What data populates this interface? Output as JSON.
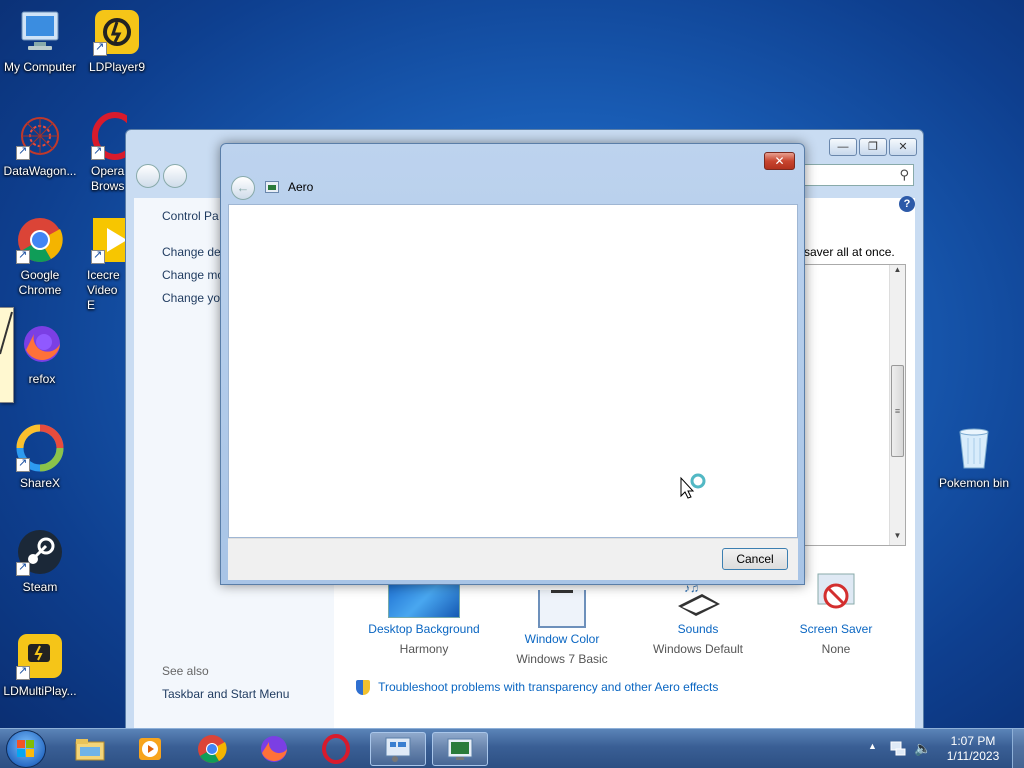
{
  "desktop": {
    "icons": [
      {
        "label": "My Computer"
      },
      {
        "label": "LDPlayer9"
      },
      {
        "label": "DataWagon..."
      },
      {
        "label": "Opera Brows"
      },
      {
        "label": "Google Chrome"
      },
      {
        "label": "Icecre Video E"
      },
      {
        "label": "refox"
      },
      {
        "label": "ShareX"
      },
      {
        "label": "Steam"
      },
      {
        "label": "LDMultiPlay..."
      },
      {
        "label": "Pokemon bin"
      }
    ]
  },
  "personalization": {
    "breadcrumb": "Control Pa",
    "left_links": [
      "Change de",
      "Change mo",
      "Change yo"
    ],
    "description_tail": "saver all at once.",
    "see_also_heading": "See also",
    "see_also_link": "Taskbar and Start Menu",
    "items": [
      {
        "title": "Desktop Background",
        "value": "Harmony"
      },
      {
        "title": "Window Color",
        "value": "Windows 7 Basic"
      },
      {
        "title": "Sounds",
        "value": "Windows Default"
      },
      {
        "title": "Screen Saver",
        "value": "None"
      }
    ],
    "troubleshoot_link": "Troubleshoot problems with transparency and other Aero effects"
  },
  "dialog": {
    "title": "Aero",
    "cancel_label": "Cancel",
    "close_label": "✕"
  },
  "taskbar": {
    "time": "1:07 PM",
    "date": "1/11/2023"
  },
  "colors": {
    "link": "#0a66c2",
    "taskbar": "#3a5f95"
  }
}
